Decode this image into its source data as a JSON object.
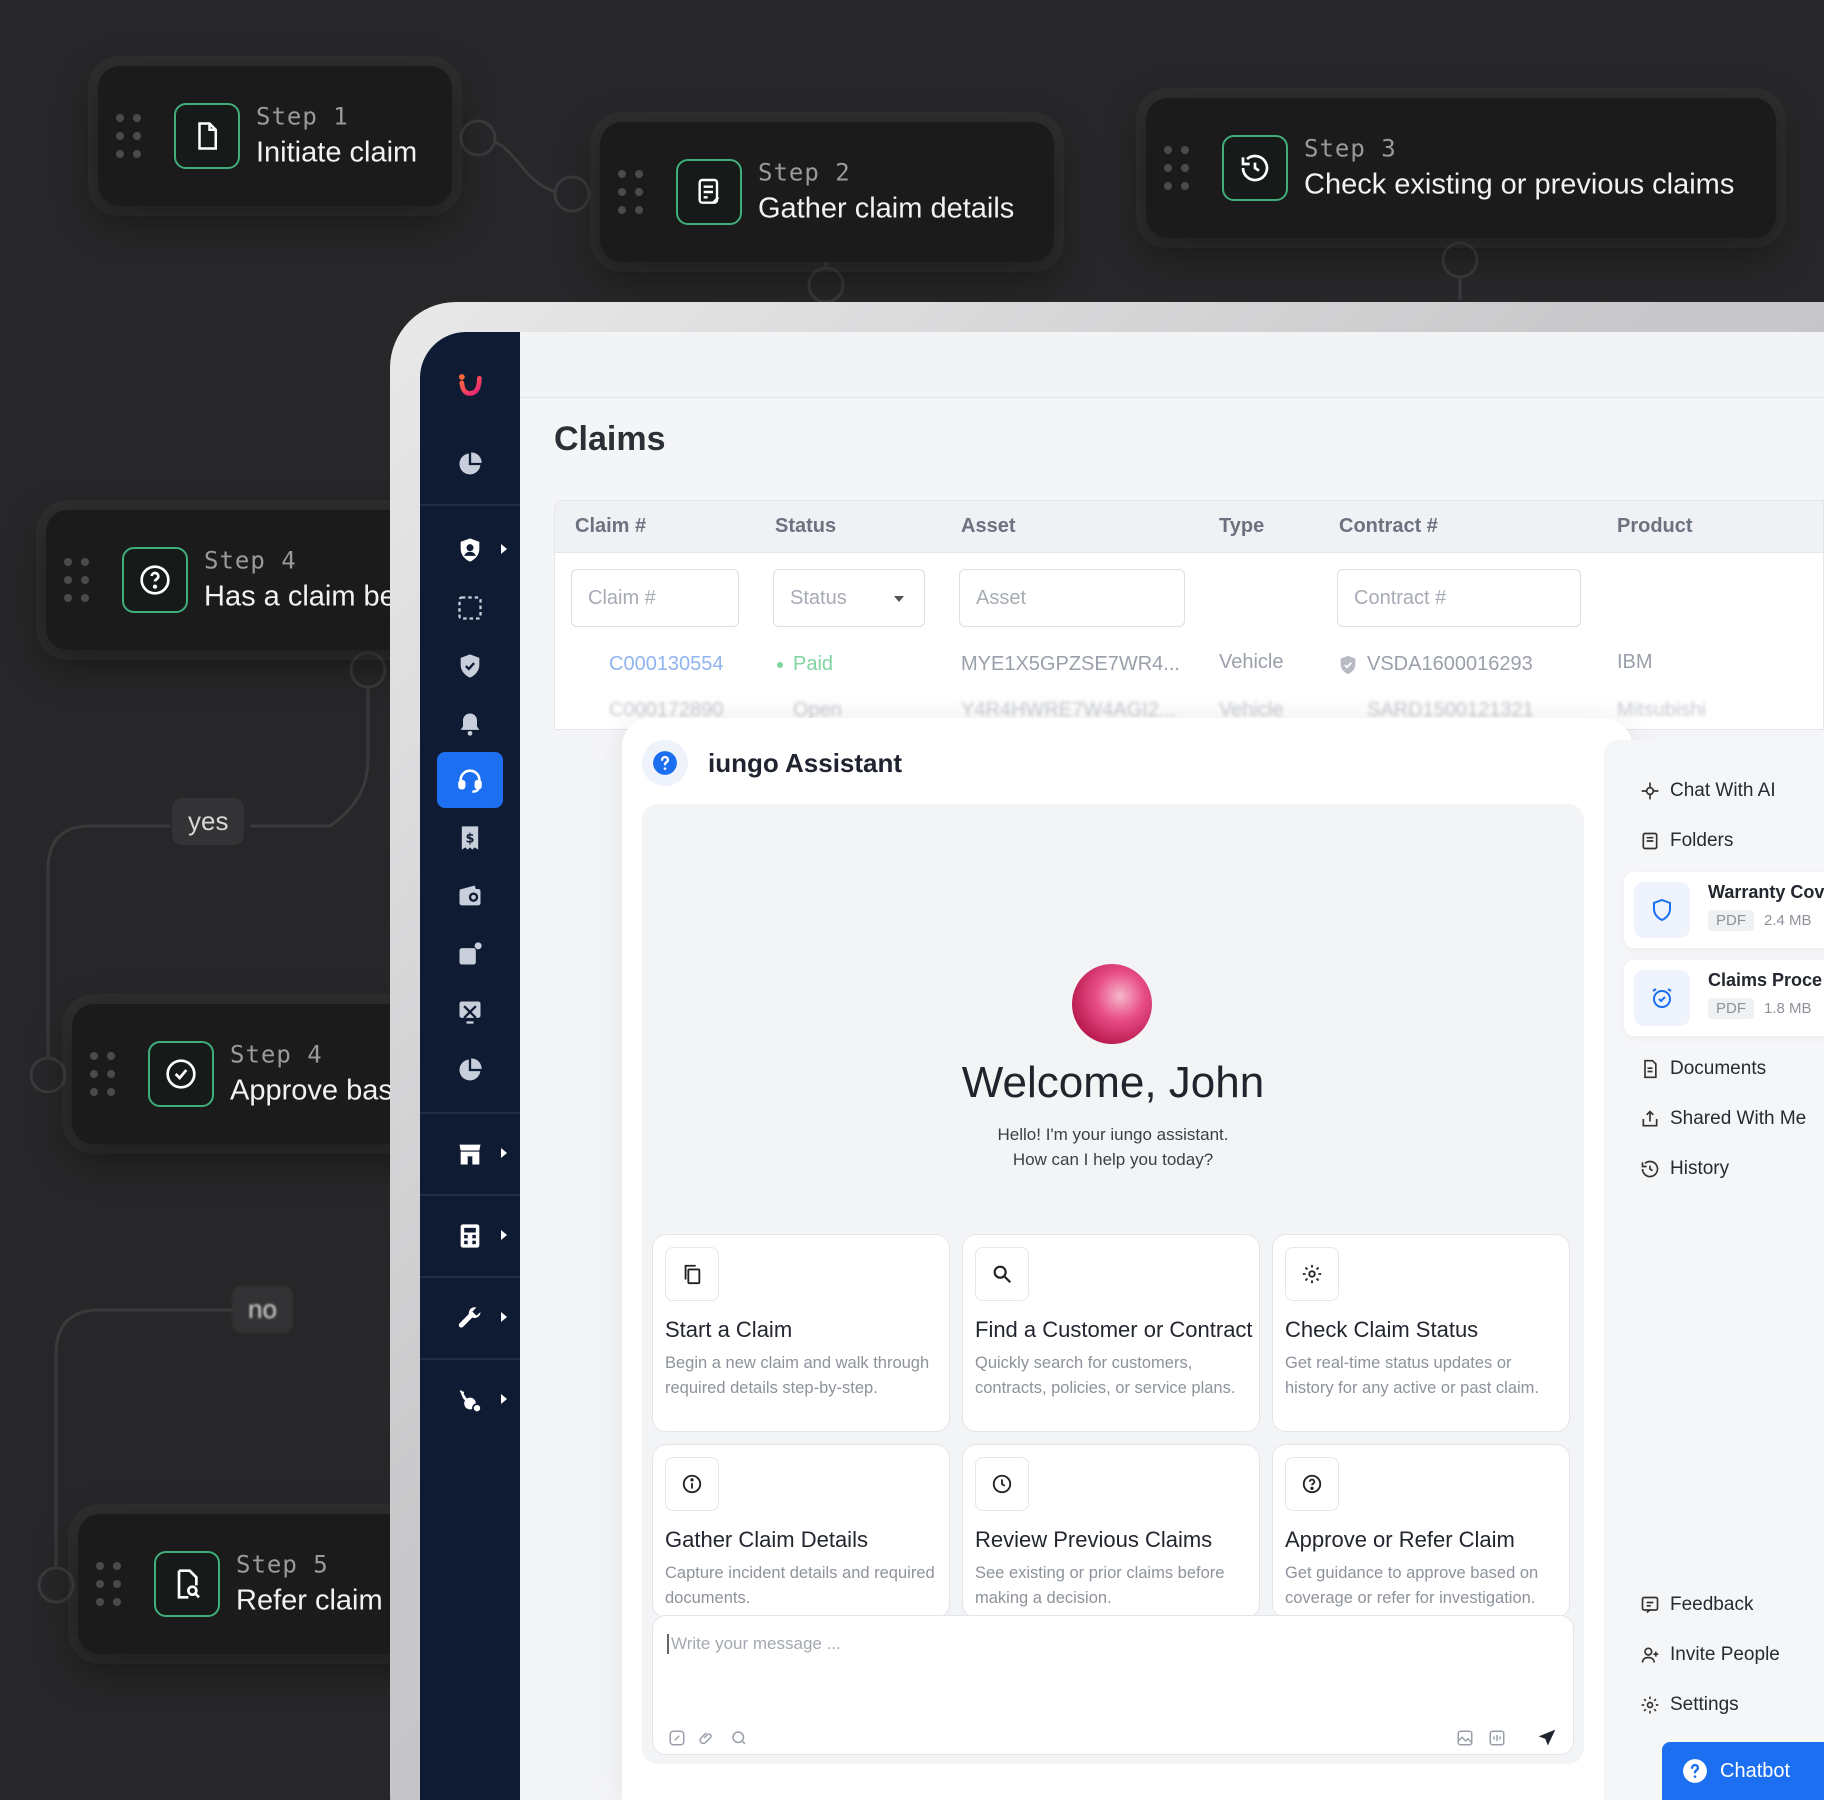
{
  "flow": {
    "steps": [
      {
        "label": "Step 1",
        "title": "Initiate claim",
        "icon": "document-icon"
      },
      {
        "label": "Step 2",
        "title": "Gather claim details",
        "icon": "form-icon"
      },
      {
        "label": "Step 3",
        "title": "Check existing or previous claims",
        "icon": "history-icon"
      },
      {
        "label": "Step 4",
        "title": "Has a claim be",
        "icon": "question-icon"
      },
      {
        "label": "Step 4",
        "title": "Approve bas",
        "icon": "check-circle-icon"
      },
      {
        "label": "Step 5",
        "title": "Refer claim",
        "icon": "file-search-icon"
      }
    ],
    "yes_label": "yes",
    "no_label": "no"
  },
  "sidebar": {
    "items": [
      "logo",
      "dashboard-icon",
      "customer-icon",
      "select-icon",
      "shield-icon",
      "bell-icon",
      "support-icon",
      "dollar-receipt-icon",
      "wallet-icon",
      "notification-card-icon",
      "tools-icon",
      "pie-chart-icon",
      "store-icon",
      "calculator-icon",
      "wrench-icon",
      "user-gear-icon"
    ],
    "active": "support-icon"
  },
  "claims": {
    "title": "Claims",
    "columns": [
      "Claim #",
      "Status",
      "Asset",
      "Type",
      "Contract #",
      "Product"
    ],
    "filters": {
      "claim": "Claim #",
      "status": "Status",
      "asset": "Asset",
      "contract": "Contract #"
    },
    "rows": [
      {
        "claim": "C000130554",
        "status": "Paid",
        "asset": "MYE1X5GPZSE7WR4...",
        "type": "Vehicle",
        "contract": "VSDA1600016293",
        "product": "IBM"
      },
      {
        "claim": "C000172890",
        "status": "Open",
        "asset": "Y4R4HWRE7W4AGI2...",
        "type": "Vehicle",
        "contract": "SARD1500121321",
        "product": "Mitsubishi"
      }
    ]
  },
  "assistant": {
    "title": "iungo Assistant",
    "welcome": "Welcome, John",
    "sub_line1": "Hello! I'm your iungo assistant.",
    "sub_line2": "How can I help you today?",
    "cards": [
      {
        "icon": "copy-icon",
        "title": "Start a Claim",
        "desc": "Begin a new claim and walk through required details step-by-step."
      },
      {
        "icon": "search-icon",
        "title": "Find a Customer or Contract",
        "desc": "Quickly search for customers, contracts, policies, or service plans."
      },
      {
        "icon": "gear-icon",
        "title": "Check Claim Status",
        "desc": "Get real-time status updates or history for any active or past claim."
      },
      {
        "icon": "info-icon",
        "title": "Gather Claim Details",
        "desc": "Capture incident details and required documents."
      },
      {
        "icon": "clock-icon",
        "title": "Review Previous Claims",
        "desc": "See existing or prior claims before making a decision."
      },
      {
        "icon": "question-icon",
        "title": "Approve or Refer Claim",
        "desc": "Get guidance to approve based on coverage or refer for investigation."
      }
    ],
    "input_placeholder": "Write your message ..."
  },
  "right_panel": {
    "chat_with_ai": "Chat With AI",
    "folders": "Folders",
    "files": [
      {
        "name": "Warranty Cov",
        "type": "PDF",
        "size": "2.4 MB",
        "icon": "shield-icon"
      },
      {
        "name": "Claims Proce",
        "type": "PDF",
        "size": "1.8 MB",
        "icon": "alarm-icon"
      }
    ],
    "documents": "Documents",
    "shared": "Shared With Me",
    "history": "History",
    "feedback": "Feedback",
    "invite": "Invite People",
    "settings": "Settings",
    "chatbot": "Chatbot"
  },
  "colors": {
    "accent": "#1c6ff0",
    "sidebar": "#0f1b33",
    "step_border": "#3fae7a",
    "paid": "#7fd4a0",
    "link": "#8fb4f0"
  }
}
